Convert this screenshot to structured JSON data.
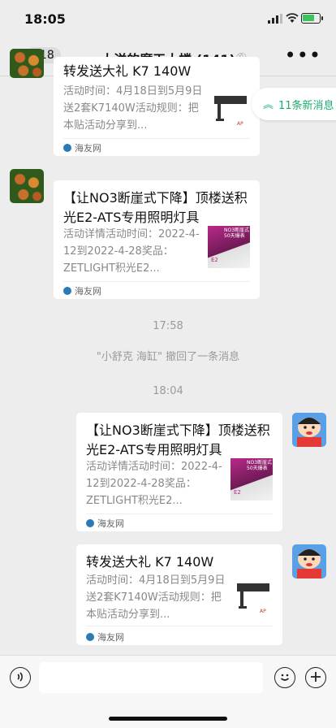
{
  "status": {
    "time": "18:05"
  },
  "header": {
    "back_count": "618",
    "title": "大洋的摩天大楼 (141)",
    "more": "•••"
  },
  "new_messages": {
    "label": "11条新消息"
  },
  "messages": [
    {
      "title": "转发送大礼 K7 140W",
      "desc": "活动时间：4月18日到5月9日送2套K7140W活动规则：把本贴活动分享到...",
      "source": "海友网"
    },
    {
      "title": "【让NO3断崖式下降】顶楼送积光E2-ATS专用照明灯具",
      "desc": "活动详情活动时间：2022-4-12到2022-4-28奖品：ZETLIGHT积光E2...",
      "source": "海友网"
    },
    {
      "title": "【让NO3断崖式下降】顶楼送积光E2-ATS专用照明灯具",
      "desc": "活动详情活动时间：2022-4-12到2022-4-28奖品：ZETLIGHT积光E2...",
      "source": "海友网"
    },
    {
      "title": "转发送大礼 K7 140W",
      "desc": "活动时间：4月18日到5月9日送2套K7140W活动规则：把本贴活动分享到...",
      "source": "海友网"
    }
  ],
  "timestamps": [
    "17:58",
    "18:04"
  ],
  "system_notice": "\"小舒克 海缸\" 撤回了一条消息",
  "thumb_text": {
    "no3": "NO3断崖式\n50天爆表",
    "e2": "E2"
  },
  "colors": {
    "accent": "#1aad6f",
    "background": "#ededed"
  }
}
